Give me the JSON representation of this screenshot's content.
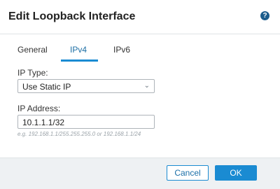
{
  "dialog": {
    "title": "Edit Loopback Interface",
    "help_glyph": "?"
  },
  "tabs": [
    {
      "label": "General",
      "active": false
    },
    {
      "label": "IPv4",
      "active": true
    },
    {
      "label": "IPv6",
      "active": false
    }
  ],
  "form": {
    "ip_type_label": "IP Type:",
    "ip_type_value": "Use Static IP",
    "ip_address_label": "IP Address:",
    "ip_address_value": "10.1.1.1/32",
    "ip_address_hint": "e.g. 192.168.1.1/255.255.255.0 or 192.168.1.1/24"
  },
  "footer": {
    "cancel_label": "Cancel",
    "ok_label": "OK"
  },
  "colors": {
    "accent": "#1a8bd2",
    "active_tab_text": "#1d6fa5",
    "help_icon": "#1d5d8c",
    "footer_bg": "#eef1f3"
  },
  "icons": {
    "help": "help-icon",
    "dropdown": "chevron-down-icon"
  }
}
